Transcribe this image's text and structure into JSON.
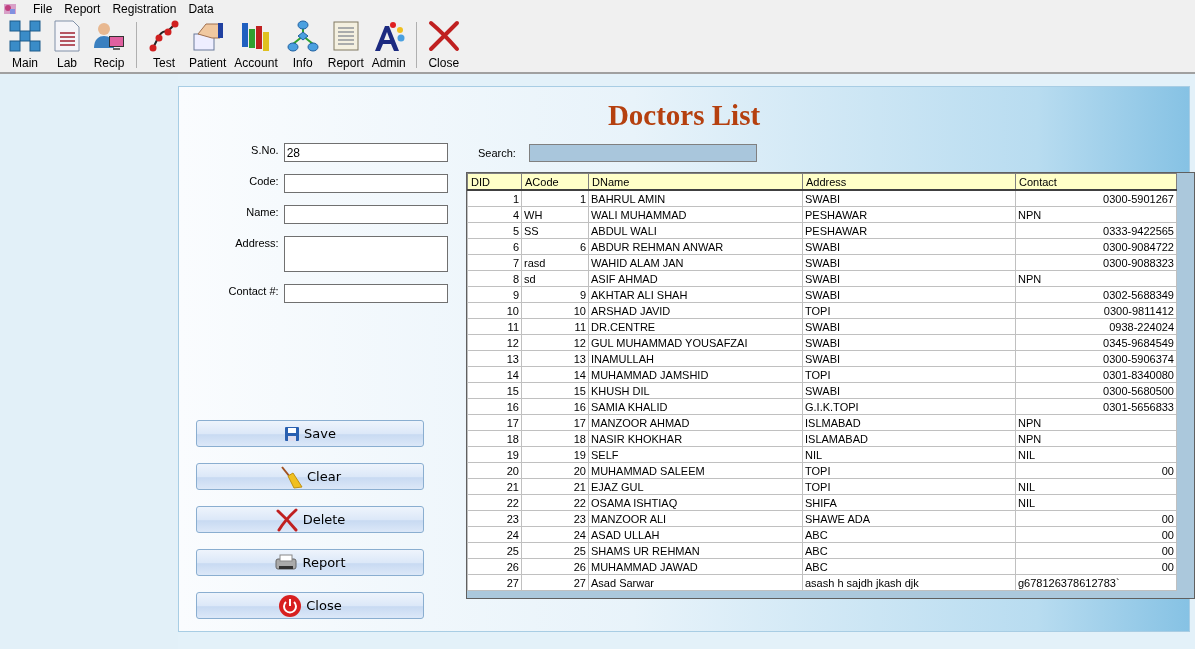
{
  "menu": [
    "File",
    "Report",
    "Registration",
    "Data"
  ],
  "toolbar": {
    "groups": [
      [
        {
          "label": "Main",
          "kind": "grid"
        },
        {
          "label": "Lab",
          "kind": "document"
        },
        {
          "label": "Recip",
          "kind": "user"
        }
      ],
      [
        {
          "label": "Test",
          "kind": "nodes"
        },
        {
          "label": "Patient",
          "kind": "hand"
        },
        {
          "label": "Account",
          "kind": "chart"
        },
        {
          "label": "Info",
          "kind": "network"
        },
        {
          "label": "Report",
          "kind": "scroll"
        },
        {
          "label": "Admin",
          "kind": "letter"
        }
      ],
      [
        {
          "label": "Close",
          "kind": "close"
        }
      ]
    ]
  },
  "title": "Doctors List",
  "form": {
    "fields": [
      {
        "label": "S.No.",
        "value": "28",
        "kind": "single"
      },
      {
        "label": "Code:",
        "kind": "single"
      },
      {
        "label": "Name:",
        "kind": "single"
      },
      {
        "label": "Address:",
        "kind": "multi"
      },
      {
        "label": "Contact #:",
        "kind": "single"
      }
    ],
    "buttons": [
      {
        "label": "Save",
        "kind": "save"
      },
      {
        "label": "Clear",
        "kind": "broom"
      },
      {
        "label": "Delete",
        "kind": "delete"
      },
      {
        "label": "Report",
        "kind": "printer"
      },
      {
        "label": "Close",
        "kind": "power"
      }
    ]
  },
  "search": {
    "label": "Search:"
  },
  "table": {
    "columns": [
      "DID",
      "ACode",
      "DName",
      "Address",
      "Contact"
    ],
    "rows": [
      [
        "1",
        "1",
        "BAHRUL AMIN",
        "SWABI",
        "0300-5901267"
      ],
      [
        "4",
        "WH",
        "WALI MUHAMMAD",
        "PESHAWAR",
        "NPN"
      ],
      [
        "5",
        "SS",
        "ABDUL WALI",
        "PESHAWAR",
        "0333-9422565"
      ],
      [
        "6",
        "6",
        "ABDUR REHMAN ANWAR",
        "SWABI",
        "0300-9084722"
      ],
      [
        "7",
        "rasd",
        "WAHID ALAM JAN",
        "SWABI",
        "0300-9088323"
      ],
      [
        "8",
        "sd",
        "ASIF AHMAD",
        "SWABI",
        "NPN"
      ],
      [
        "9",
        "9",
        "AKHTAR ALI SHAH",
        "SWABI",
        "0302-5688349"
      ],
      [
        "10",
        "10",
        "ARSHAD JAVID",
        "TOPI",
        "0300-9811412"
      ],
      [
        "11",
        "11",
        "DR.CENTRE",
        "SWABI",
        "0938-224024"
      ],
      [
        "12",
        "12",
        "GUL MUHAMMAD YOUSAFZAI",
        "SWABI",
        "0345-9684549"
      ],
      [
        "13",
        "13",
        "INAMULLAH",
        "SWABI",
        "0300-5906374"
      ],
      [
        "14",
        "14",
        "MUHAMMAD JAMSHID",
        "TOPI",
        "0301-8340080"
      ],
      [
        "15",
        "15",
        "KHUSH DIL",
        "SWABI",
        "0300-5680500"
      ],
      [
        "16",
        "16",
        "SAMIA KHALID",
        "G.I.K.TOPI",
        "0301-5656833"
      ],
      [
        "17",
        "17",
        "MANZOOR AHMAD",
        "ISLMABAD",
        "NPN"
      ],
      [
        "18",
        "18",
        "NASIR KHOKHAR",
        "ISLAMABAD",
        "NPN"
      ],
      [
        "19",
        "19",
        "SELF",
        "NIL",
        "NIL"
      ],
      [
        "20",
        "20",
        "MUHAMMAD SALEEM",
        "TOPI",
        "00"
      ],
      [
        "21",
        "21",
        "EJAZ GUL",
        "TOPI",
        "NIL"
      ],
      [
        "22",
        "22",
        "OSAMA ISHTIAQ",
        "SHIFA",
        "NIL"
      ],
      [
        "23",
        "23",
        "MANZOOR ALI",
        "SHAWE ADA",
        "00"
      ],
      [
        "24",
        "24",
        "ASAD ULLAH",
        "ABC",
        "00"
      ],
      [
        "25",
        "25",
        "SHAMS UR REHMAN",
        "ABC",
        "00"
      ],
      [
        "26",
        "26",
        "MUHAMMAD JAWAD",
        "ABC",
        "00"
      ],
      [
        "27",
        "27",
        "Asad Sarwar",
        "asash h sajdh jkash djk",
        "g678126378612783`"
      ]
    ]
  }
}
